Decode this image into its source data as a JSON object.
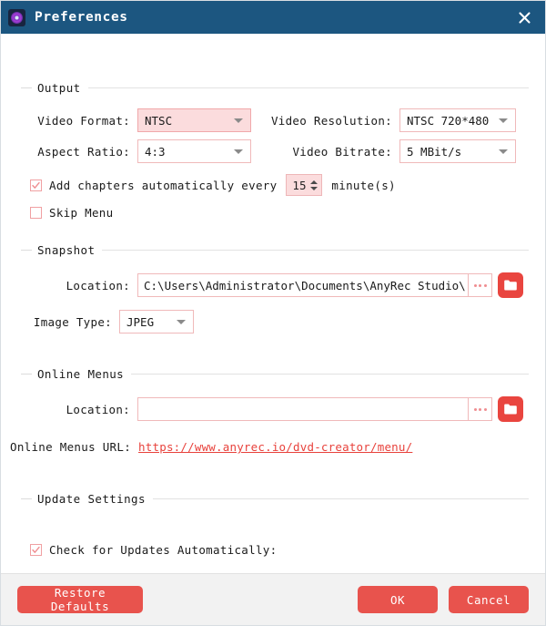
{
  "window": {
    "title": "Preferences",
    "icon": "app-target-icon",
    "close_label": "✕",
    "titlebar_color": "#1c5680",
    "accent_color": "#e8534d",
    "field_border_color": "#f0b9ba",
    "link_color": "#e8423c"
  },
  "sections": {
    "output": {
      "title": "Output",
      "video_format": {
        "label": "Video Format:",
        "value": "NTSC",
        "state": "hover"
      },
      "video_resolution": {
        "label": "Video Resolution:",
        "value": "NTSC 720*480",
        "state": "normal"
      },
      "aspect_ratio": {
        "label": "Aspect Ratio:",
        "value": "4:3",
        "state": "normal"
      },
      "video_bitrate": {
        "label": "Video Bitrate:",
        "value": "5 MBit/s",
        "state": "normal"
      },
      "add_chapters": {
        "label_before": "Add chapters automatically every",
        "checked": true,
        "minutes": "15",
        "label_after": "minute(s)"
      },
      "skip_menu": {
        "label": "Skip Menu",
        "checked": false
      }
    },
    "snapshot": {
      "title": "Snapshot",
      "location": {
        "label": "Location:",
        "value": "C:\\Users\\Administrator\\Documents\\AnyRec Studio\\",
        "placeholder": "",
        "browse_label": "...",
        "folder_icon": "folder-icon"
      },
      "image_type": {
        "label": "Image Type:",
        "value": "JPEG"
      }
    },
    "online_menus": {
      "title": "Online Menus",
      "location": {
        "label": "Location:",
        "value": "",
        "placeholder": "",
        "browse_label": "...",
        "folder_icon": "folder-icon"
      },
      "url_row": {
        "label": "Online Menus URL:",
        "url": "https://www.anyrec.io/dvd-creator/menu/"
      }
    },
    "update_settings": {
      "title": "Update Settings",
      "check_updates": {
        "label": "Check for Updates Automatically:",
        "checked": true
      }
    }
  },
  "footer": {
    "restore_defaults": "Restore Defaults",
    "ok": "OK",
    "cancel": "Cancel"
  }
}
